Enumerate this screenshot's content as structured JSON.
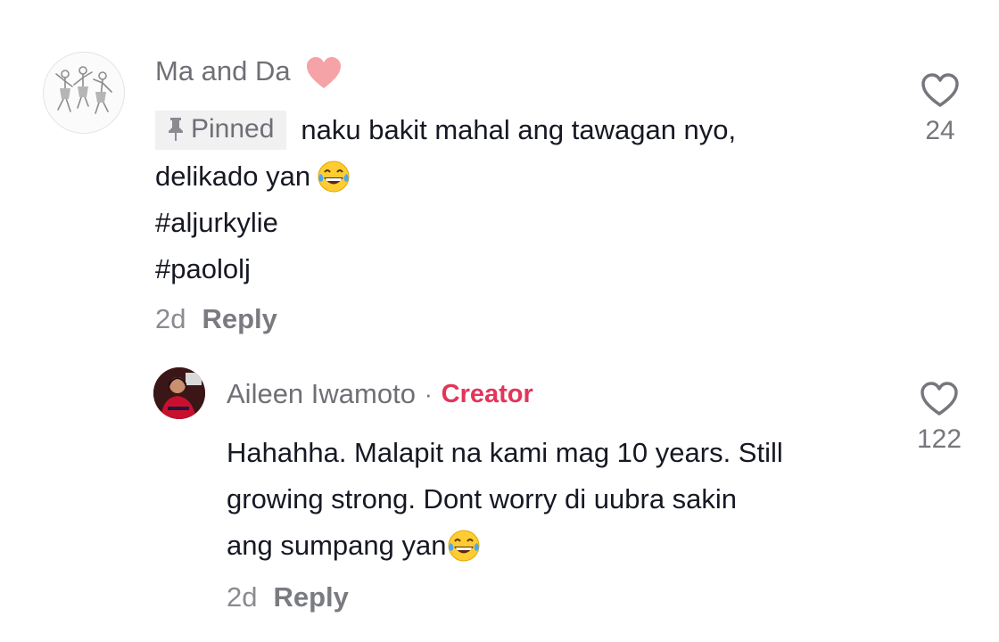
{
  "comments": [
    {
      "username": "Ma and Da",
      "name_emoji": "pink-heart-icon",
      "pinned_label": "Pinned",
      "text_lines": [
        "naku bakit mahal ang tawagan nyo,",
        "delikado yan",
        "#aljurkylie",
        "#paololj"
      ],
      "time": "2d",
      "reply_label": "Reply",
      "likes": "24"
    },
    {
      "username": "Aileen Iwamoto",
      "separator": "·",
      "badge": "Creator",
      "text_lines": [
        "Hahahha. Malapit na kami mag 10 years. Still",
        "growing strong. Dont worry di uubra sakin",
        "ang sumpang yan"
      ],
      "time": "2d",
      "reply_label": "Reply",
      "likes": "122"
    }
  ],
  "colors": {
    "username": "#6f7076",
    "creator_badge": "#e3355a",
    "body_text": "#161823",
    "pinned_bg": "#f1f1f2",
    "muted": "#8a8b91"
  }
}
